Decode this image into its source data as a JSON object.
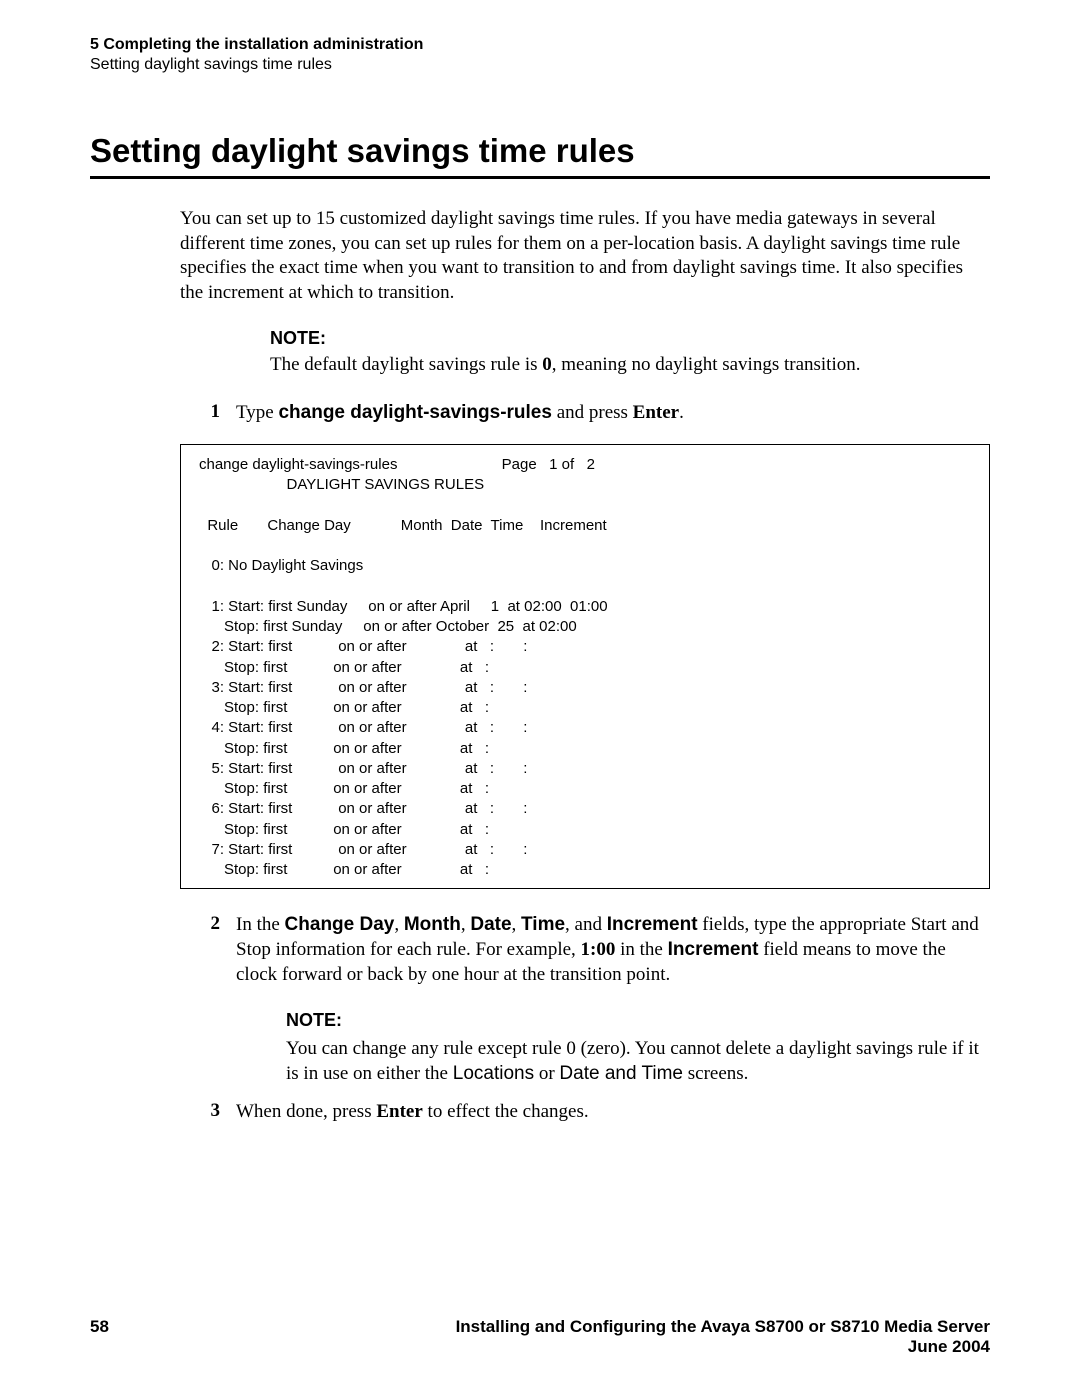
{
  "header": {
    "chapter": "5  Completing the installation administration",
    "section": "Setting daylight savings time rules"
  },
  "title": "Setting daylight savings time rules",
  "intro": "You can set up to 15 customized daylight savings time rules. If you have media gateways in several different time zones, you can set up rules for them on a per-location basis. A daylight savings time rule specifies the exact time when you want to transition to and from daylight savings time. It also specifies the increment at which to transition.",
  "notes": {
    "note_label": "NOTE:",
    "note1_pre": "The default daylight savings rule is ",
    "note1_bold": "0",
    "note1_post": ", meaning no daylight savings transition.",
    "note2_pre": "You can change any rule except rule 0 (zero). You cannot delete a daylight savings rule if it is in use on either the ",
    "note2_loc": "Locations",
    "note2_mid": " or ",
    "note2_dat": "Date and Time",
    "note2_post": " screens."
  },
  "steps": {
    "s1": {
      "n": "1",
      "t1": "Type ",
      "cmd": "change daylight-savings-rules",
      "t2": " and press ",
      "enter": "Enter",
      "t3": "."
    },
    "s2": {
      "n": "2",
      "t1": "In the ",
      "f1": "Change Day",
      "t2": ", ",
      "f2": "Month",
      "t3": ", ",
      "f3": "Date",
      "t4": ", ",
      "f4": "Time",
      "t5": ", and ",
      "f5": "Increment",
      "t6": " fields, type the appropriate Start and Stop information for each rule. For example, ",
      "v": "1:00",
      "t7": " in the ",
      "f6": "Increment",
      "t8": " field means to move the clock forward or back by one hour at the transition point."
    },
    "s3": {
      "n": "3",
      "t1": "When done, press ",
      "enter": "Enter",
      "t2": " to effect the changes."
    }
  },
  "terminal": "change daylight-savings-rules                         Page   1 of   2\n                     DAYLIGHT SAVINGS RULES\n\n  Rule       Change Day            Month  Date  Time    Increment\n\n   0: No Daylight Savings\n\n   1: Start: first Sunday     on or after April     1  at 02:00  01:00\n      Stop: first Sunday     on or after October  25  at 02:00\n   2: Start: first           on or after              at   :       :\n      Stop: first           on or after              at   :\n   3: Start: first           on or after              at   :       :\n      Stop: first           on or after              at   :\n   4: Start: first           on or after              at   :       :\n      Stop: first           on or after              at   :\n   5: Start: first           on or after              at   :       :\n      Stop: first           on or after              at   :\n   6: Start: first           on or after              at   :       :\n      Stop: first           on or after              at   :\n   7: Start: first           on or after              at   :       :\n      Stop: first           on or after              at   :",
  "footer": {
    "page": "58",
    "book": "Installing and Configuring the Avaya S8700 or S8710 Media Server",
    "date": "June 2004"
  }
}
